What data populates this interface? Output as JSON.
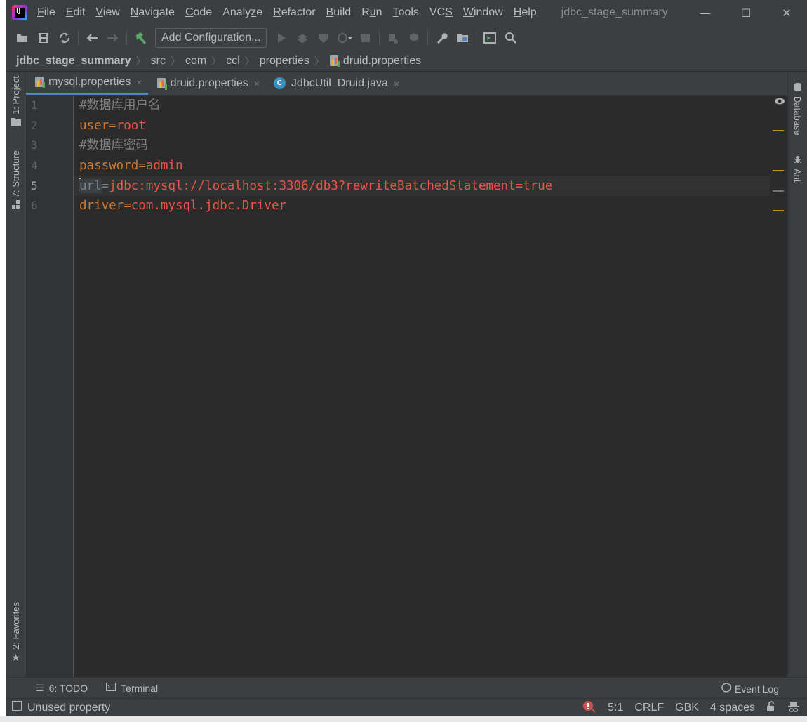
{
  "menu": {
    "items": [
      {
        "pre": "",
        "u": "F",
        "post": "ile"
      },
      {
        "pre": "",
        "u": "E",
        "post": "dit"
      },
      {
        "pre": "",
        "u": "V",
        "post": "iew"
      },
      {
        "pre": "",
        "u": "N",
        "post": "avigate"
      },
      {
        "pre": "",
        "u": "C",
        "post": "ode"
      },
      {
        "pre": "Analy",
        "u": "z",
        "post": "e"
      },
      {
        "pre": "",
        "u": "R",
        "post": "efactor"
      },
      {
        "pre": "",
        "u": "B",
        "post": "uild"
      },
      {
        "pre": "R",
        "u": "u",
        "post": "n"
      },
      {
        "pre": "",
        "u": "T",
        "post": "ools"
      },
      {
        "pre": "VC",
        "u": "S",
        "post": ""
      },
      {
        "pre": "",
        "u": "W",
        "post": "indow"
      },
      {
        "pre": "",
        "u": "H",
        "post": "elp"
      }
    ]
  },
  "window": {
    "title": "jdbc_stage_summary",
    "minimize": "—",
    "maximize": "☐",
    "close": "✕"
  },
  "toolbar": {
    "add_configuration": "Add Configuration..."
  },
  "breadcrumb": {
    "items": [
      "jdbc_stage_summary",
      "src",
      "com",
      "ccl",
      "properties",
      "druid.properties"
    ],
    "sep": "〉"
  },
  "left_tools": {
    "project": "1: Project",
    "structure": "7: Structure",
    "favorites": "2: Favorites"
  },
  "right_tools": {
    "database": "Database",
    "ant": "Ant"
  },
  "tabs": [
    {
      "label": "mysql.properties",
      "close": "×"
    },
    {
      "label": "druid.properties",
      "close": "×"
    },
    {
      "label": "JdbcUtil_Druid.java",
      "close": "×"
    }
  ],
  "java_icon_letter": "C",
  "editor": {
    "line_numbers": [
      "1",
      "2",
      "3",
      "4",
      "5",
      "6"
    ],
    "current_line": "5",
    "lines": {
      "l1_comment": "#数据库用户名",
      "l2_key": "user",
      "l2_eq": "=",
      "l2_val": "root",
      "l3_comment": "#数据库密码",
      "l4_key": "password",
      "l4_eq": "=",
      "l4_val": "admin",
      "l5_key": "url",
      "l5_eq": "=",
      "l5_val": "jdbc:mysql://localhost:3306/db3?rewriteBatchedStatement=true",
      "l6_key": "driver",
      "l6_eq": "=",
      "l6_val": "com.mysql.jdbc.Driver"
    }
  },
  "bottom_tools": {
    "todo_num": "6",
    "todo_label": ": TODO",
    "terminal": "Terminal",
    "event_log": "Event Log"
  },
  "status": {
    "message": "Unused property",
    "position": "5:1",
    "line_separator": "CRLF",
    "encoding": "GBK",
    "indent": "4 spaces"
  },
  "colors": {
    "background": "#3c3f41",
    "editor_bg": "#2b2b2b",
    "key": "#cc7832",
    "value": "#e8564a",
    "comment": "#808080",
    "marker": "#be9117"
  }
}
